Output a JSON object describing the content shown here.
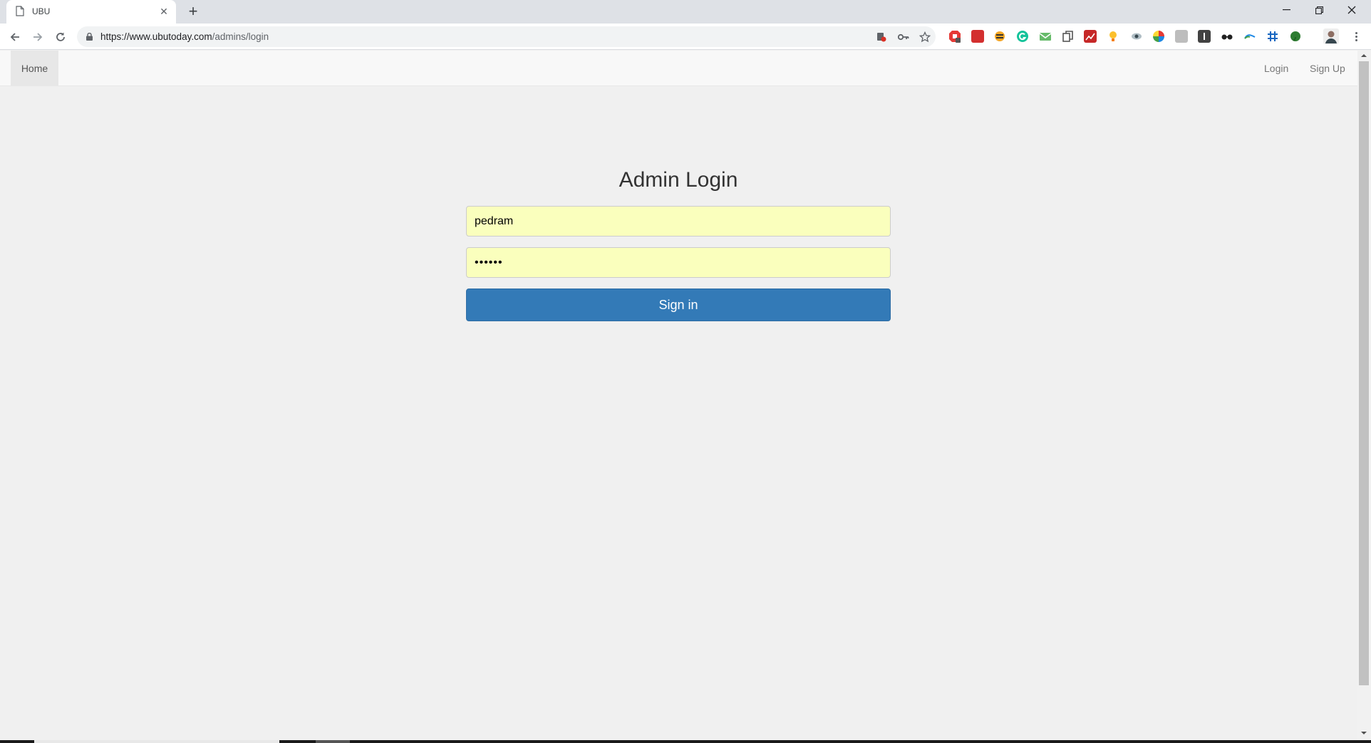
{
  "browser": {
    "tab_title": "UBU",
    "url_host": "https://www.ubutoday.com",
    "url_path": "/admins/login"
  },
  "navbar": {
    "home": "Home",
    "login": "Login",
    "signup": "Sign Up"
  },
  "login": {
    "title": "Admin Login",
    "username_value": "pedram",
    "password_value": "••••••",
    "signin_label": "Sign in"
  },
  "colors": {
    "primary_button": "#337ab7",
    "autofill_background": "#faffbd",
    "page_background": "#f0f0f0"
  }
}
